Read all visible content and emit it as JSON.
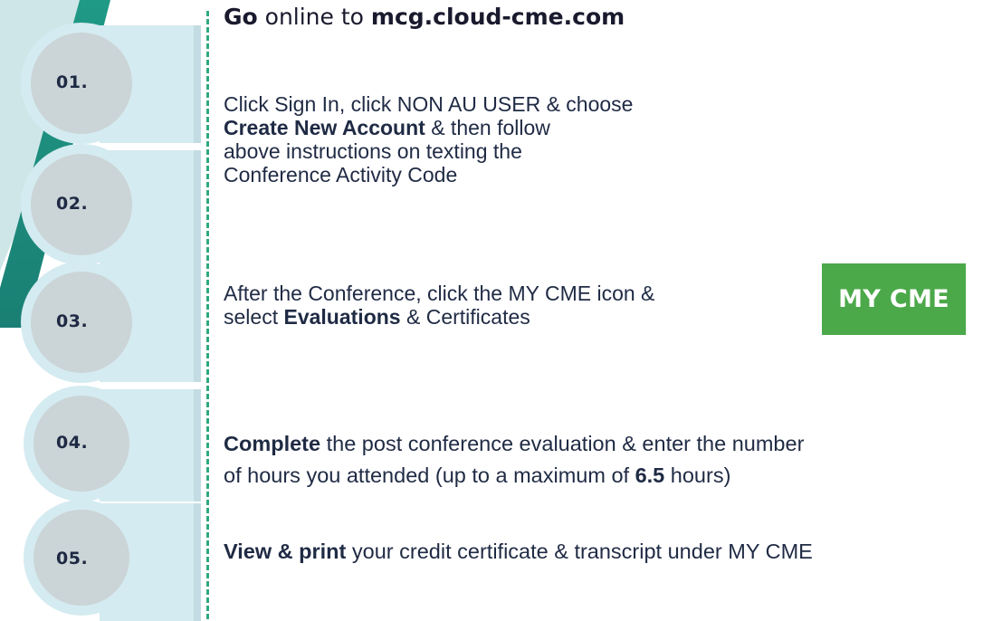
{
  "steps": [
    {
      "number": "01.",
      "segments": [
        {
          "text": "Go",
          "bold": true
        },
        {
          "text": " online to ",
          "bold": false
        },
        {
          "text": "mcg.cloud-cme.com",
          "bold": true
        }
      ]
    },
    {
      "number": "02.",
      "segments": [
        {
          "text": "Click Sign In, click NON AU USER & choose",
          "bold": false
        },
        {
          "text": "Create New Account",
          "bold": true
        },
        {
          "text": " & then follow",
          "bold": false
        },
        {
          "text": "above instructions on texting the",
          "bold": false
        },
        {
          "text": "Conference Activity Code",
          "bold": false
        }
      ]
    },
    {
      "number": "03.",
      "segments": [
        {
          "text": "After the Conference, click the MY CME icon &",
          "bold": false
        },
        {
          "text": "select ",
          "bold": false
        },
        {
          "text": "Evaluations",
          "bold": true
        },
        {
          "text": " & Certificates",
          "bold": false
        }
      ]
    },
    {
      "number": "04.",
      "segments": [
        {
          "text": "Complete",
          "bold": true
        },
        {
          "text": " the post conference evaluation & enter the number",
          "bold": false
        },
        {
          "text": "of hours you attended (up to a maximum of ",
          "bold": false
        },
        {
          "text": "6.5",
          "bold": true
        },
        {
          "text": " hours)",
          "bold": false
        }
      ]
    },
    {
      "number": "05.",
      "segments": [
        {
          "text": "View & print",
          "bold": true
        },
        {
          "text": " your credit certificate & transcript under MY CME",
          "bold": false
        }
      ]
    }
  ],
  "button": {
    "label": "MY CME"
  },
  "colors": {
    "accent_green": "#23b58a",
    "teal": "#1f9a86",
    "button_green": "#4ba94a",
    "badge_light": "#d4ebf1",
    "badge_gray": "#cbd4d6",
    "text_dark": "#1f2a44"
  }
}
